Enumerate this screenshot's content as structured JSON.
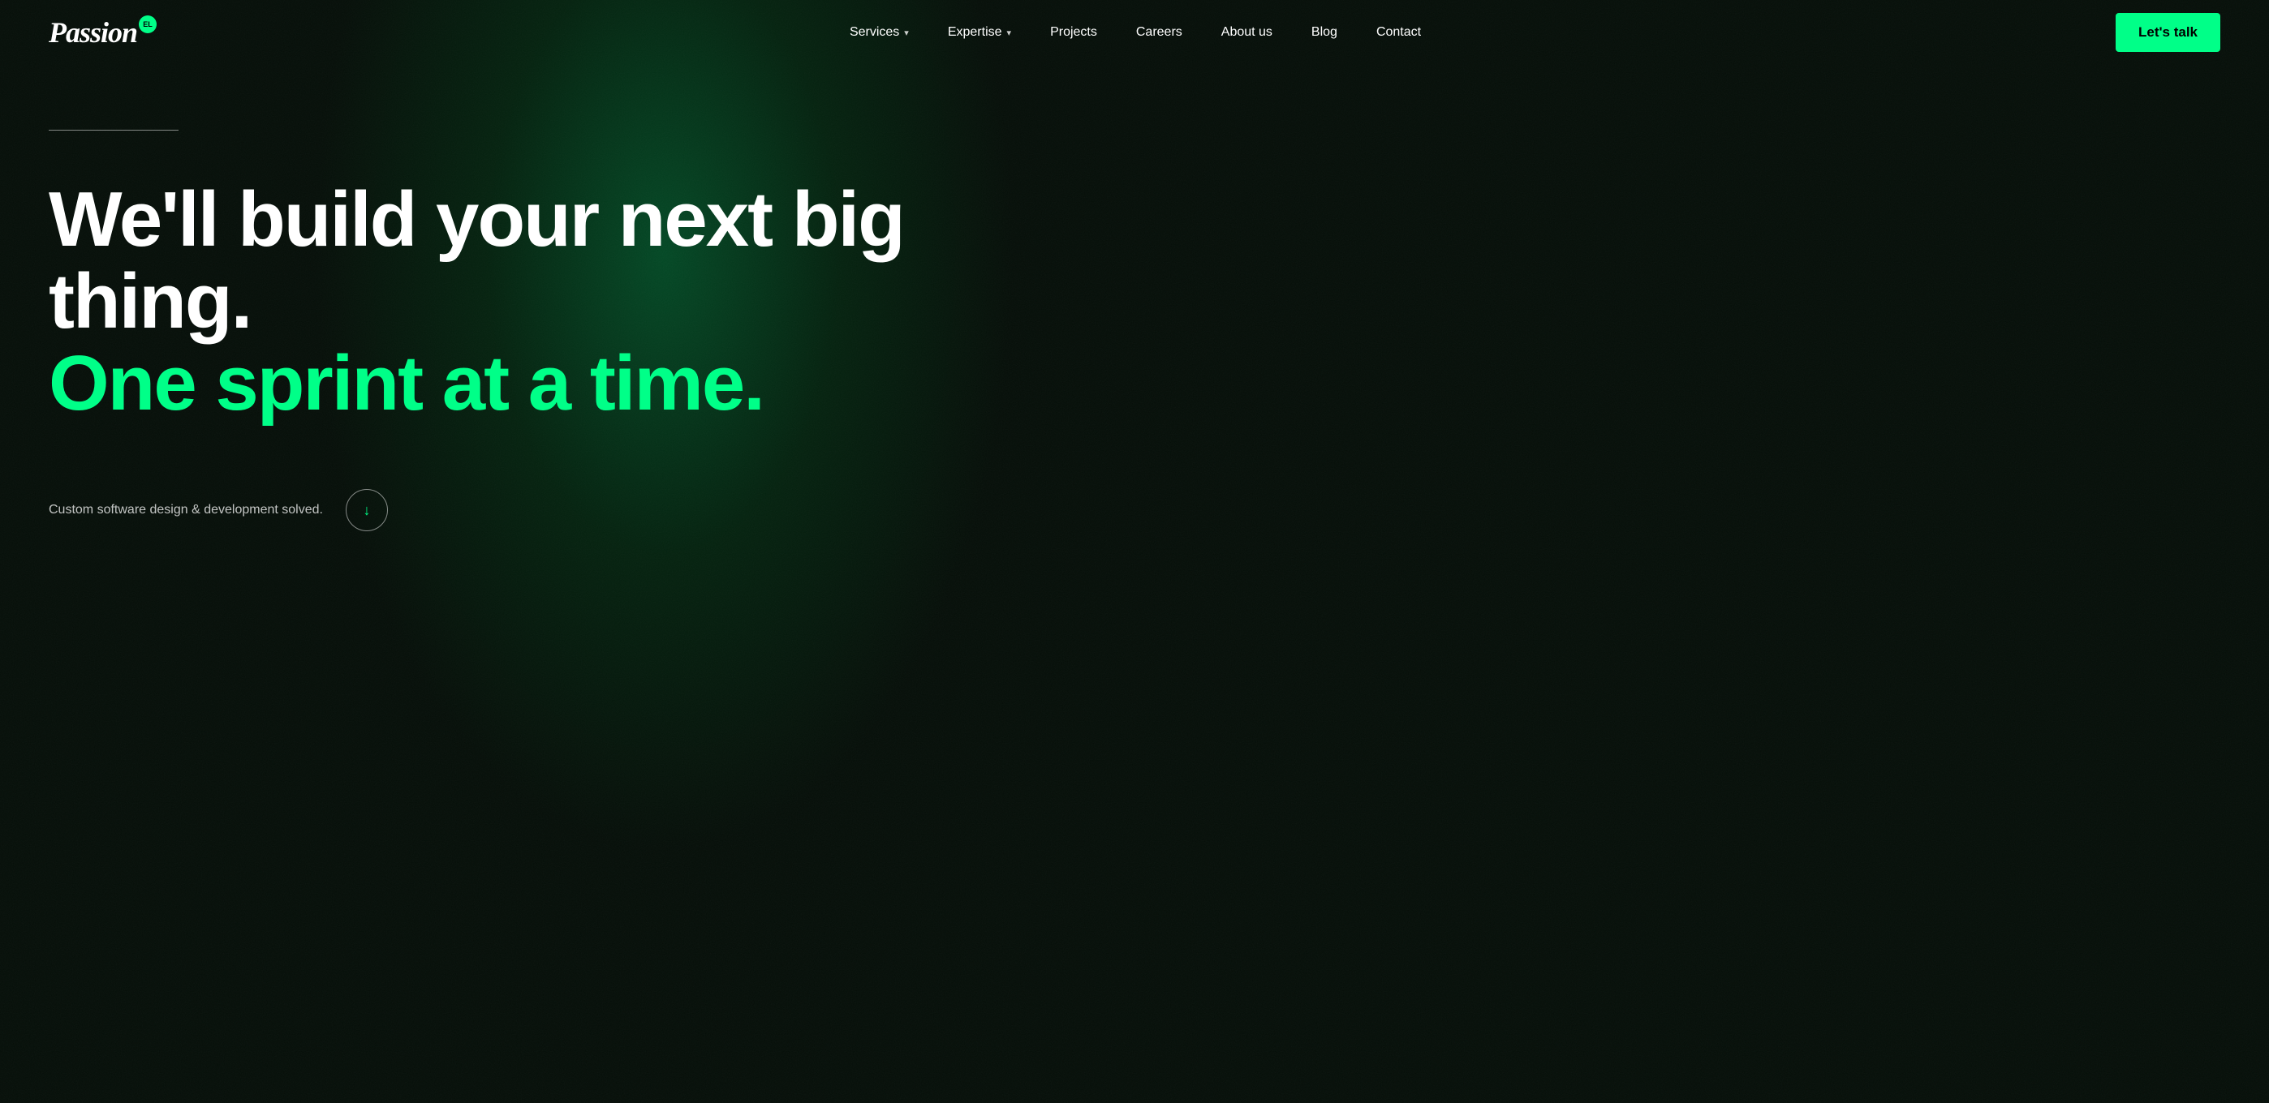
{
  "nav": {
    "logo": {
      "badge": "EL",
      "wordmark": "Passion"
    },
    "links": [
      {
        "id": "services",
        "label": "Services",
        "hasDropdown": true
      },
      {
        "id": "expertise",
        "label": "Expertise",
        "hasDropdown": true
      },
      {
        "id": "projects",
        "label": "Projects",
        "hasDropdown": false
      },
      {
        "id": "careers",
        "label": "Careers",
        "hasDropdown": false
      },
      {
        "id": "about",
        "label": "About us",
        "hasDropdown": false
      },
      {
        "id": "blog",
        "label": "Blog",
        "hasDropdown": false
      },
      {
        "id": "contact",
        "label": "Contact",
        "hasDropdown": false
      }
    ],
    "cta": "Let's talk"
  },
  "hero": {
    "headline_white": "We'll build your next big thing.",
    "headline_green": "One sprint at a time.",
    "subtext": "Custom software design & development solved.",
    "scroll_arrow": "↓",
    "divider_visible": true
  },
  "colors": {
    "accent": "#00ff88",
    "background": "#050e08",
    "text_primary": "#ffffff",
    "text_muted": "rgba(255,255,255,0.75)"
  }
}
